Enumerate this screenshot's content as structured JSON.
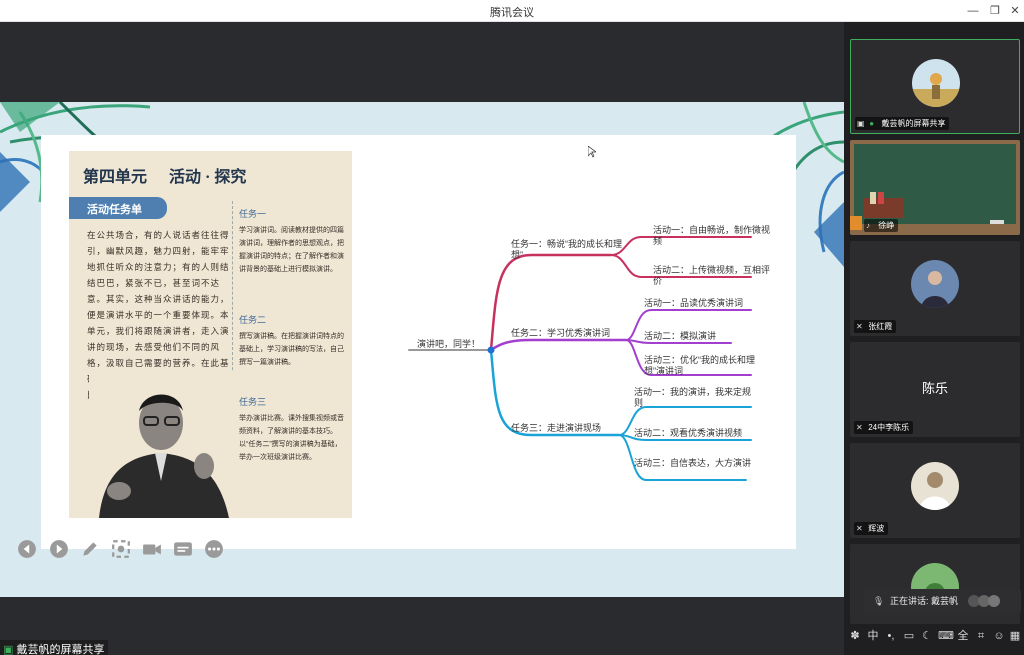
{
  "window": {
    "title": "腾讯会议",
    "min_glyph": "—",
    "max_glyph": "❐",
    "close_glyph": "✕"
  },
  "share": {
    "bottom_label": "戴芸帆的屏幕共享",
    "book": {
      "unit_title": "第四单元",
      "unit_subtitle": "活动 · 探究",
      "task_list_label": "活动任务单",
      "body_text": "在公共场合，有的人说话者往往得引，幽默风趣，魅力四射，能牢牢地抓住听众的注意力；有的人则结结巴巴，紧张不已，甚至词不达意。其实，这种当众讲话的能力，便是演讲水平的一个重要体现。本单元，我们将跟随演讲者，走入演讲的现场，去感受他们不同的风格，汲取自己需要的营养。在此基础上，学习撰写演讲稿，举办演讲比赛。",
      "tasks": [
        {
          "title": "任务一",
          "body": "学习演讲词。阅读教材提供的四篇演讲词，理解作者的思想观点，把握演讲词的特点；在了解作者和演讲背景的基础上进行模拟演讲。"
        },
        {
          "title": "任务二",
          "body": "撰写演讲稿。在把握演讲词特点的基础上，学习演讲稿的写法，自己撰写一篇演讲稿。"
        },
        {
          "title": "任务三",
          "body": "举办演讲比赛。课外搜集视频或音频资料，了解演讲的基本技巧。以“任务二”撰写的演讲稿为基础，举办一次班级演讲比赛。"
        }
      ]
    },
    "mindmap": {
      "root": "演讲吧，同学！",
      "branches": [
        {
          "label": "任务一：畅说“我的成长和理想”",
          "color": "#c8305e",
          "children": [
            "活动一：自由畅说，制作微视频",
            "活动二：上传微视频，互相评价"
          ]
        },
        {
          "label": "任务二：学习优秀演讲词",
          "color": "#a23fcf",
          "children": [
            "活动一：品读优秀演讲词",
            "活动二：模拟演讲",
            "活动三：优化“我的成长和理想”演讲词"
          ]
        },
        {
          "label": "任务三：走进演讲现场",
          "color": "#1aa3d6",
          "children": [
            "活动一：我的演讲，我来定规则",
            "活动二：观看优秀演讲视频",
            "活动三：自信表达，大方演讲"
          ]
        }
      ]
    }
  },
  "participants": [
    {
      "name": "戴芸帆的屏幕共享",
      "kind": "avatar",
      "active": true
    },
    {
      "name": "徐峥",
      "kind": "video"
    },
    {
      "name": "张红霞",
      "kind": "avatar"
    },
    {
      "name": "24中李陈乐",
      "kind": "text",
      "display": "陈乐"
    },
    {
      "name": "辉波",
      "kind": "avatar"
    },
    {
      "name": "",
      "kind": "avatar"
    }
  ],
  "speaking": {
    "label": "正在讲话: 戴芸帆"
  },
  "ime": {
    "lang_glyph": "中",
    "punct_glyph": "•,",
    "full_glyph": "全"
  }
}
